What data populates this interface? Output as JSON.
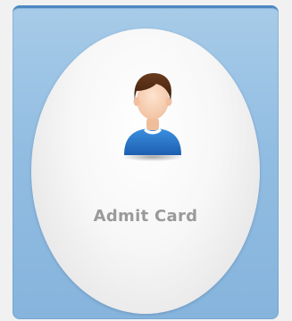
{
  "tile": {
    "label": "Admit Card",
    "icon": "user-avatar-icon"
  },
  "colors": {
    "tile_background": "#92bde2",
    "tile_border_top": "#4d88c2",
    "label_text": "#9a9a9a",
    "page_background": "#f1f1f1"
  }
}
